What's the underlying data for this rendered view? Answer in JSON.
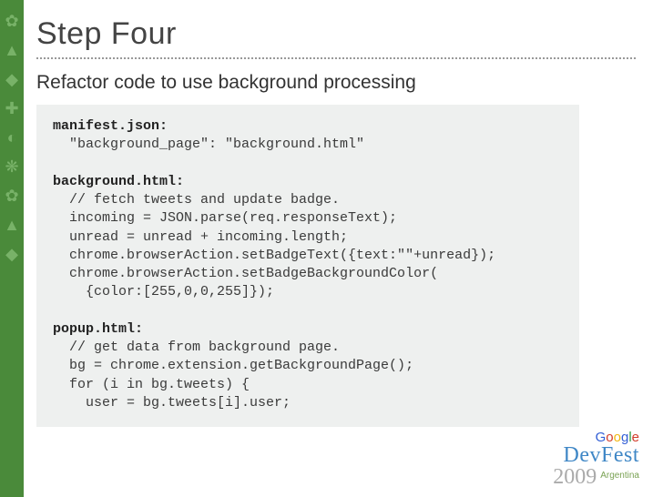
{
  "title": "Step Four",
  "subtitle": "Refactor code to use background processing",
  "code": {
    "sec1_header": "manifest.json:",
    "sec1_body": "  \"background_page\": \"background.html\"",
    "sec2_header": "background.html:",
    "sec2_body": "  // fetch tweets and update badge.\n  incoming = JSON.parse(req.responseText);\n  unread = unread + incoming.length;\n  chrome.browserAction.setBadgeText({text:\"\"+unread});\n  chrome.browserAction.setBadgeBackgroundColor(\n    {color:[255,0,0,255]});",
    "sec3_header": "popup.html:",
    "sec3_body": "  // get data from background page.\n  bg = chrome.extension.getBackgroundPage();\n  for (i in bg.tweets) {\n    user = bg.tweets[i].user;"
  },
  "sidebar_icons": [
    "gear-icon",
    "android-icon",
    "app-icon",
    "puzzle-icon",
    "wave-icon",
    "misc-icon",
    "gear-icon",
    "android-icon",
    "app-icon"
  ],
  "footer": {
    "google": {
      "g1": "G",
      "o1": "o",
      "o2": "o",
      "g2": "g",
      "l": "l",
      "e": "e"
    },
    "brand": "DevFest",
    "year": "2009",
    "region": "Argentina"
  }
}
